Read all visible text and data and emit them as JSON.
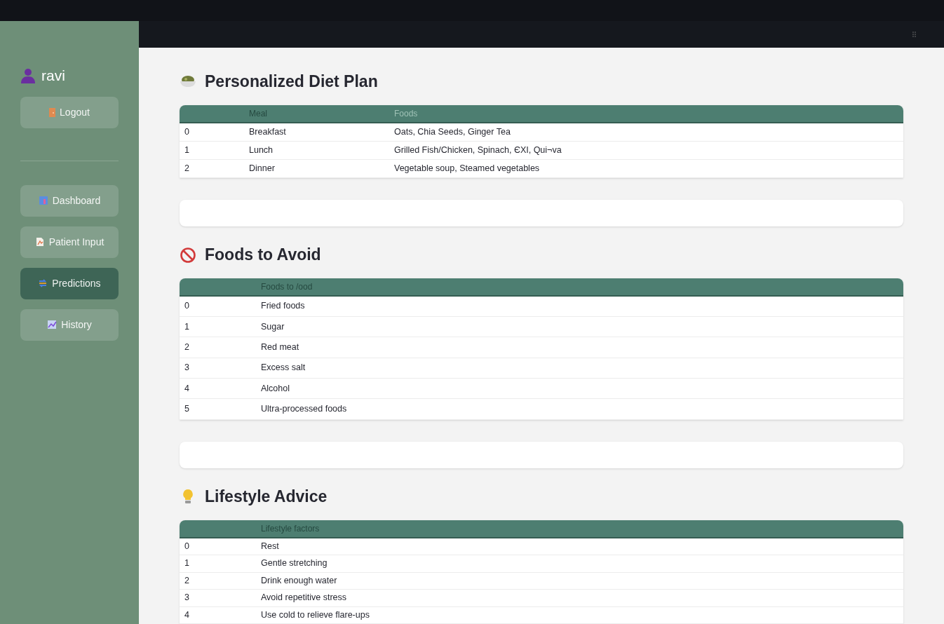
{
  "user": {
    "name": "ravi"
  },
  "logout": {
    "label": "Logout"
  },
  "nav": [
    {
      "label": "Dashboard",
      "kind": "chart",
      "selected": false
    },
    {
      "label": "Patient Input",
      "kind": "clipboard",
      "selected": false
    },
    {
      "label": "Predictions",
      "kind": "shuffle",
      "selected": true
    },
    {
      "label": "History",
      "kind": "trend",
      "selected": false
    }
  ],
  "sections": [
    {
      "title": "Personalized Diet Plan",
      "kind": "bowl",
      "table": {
        "columns": [
          "Meal",
          "Foods"
        ],
        "rows": [
          {
            "index": "0",
            "cells": [
              "Breakfast",
              "Oats, Chia Seeds, Ginger Tea"
            ]
          },
          {
            "index": "1",
            "cells": [
              "Lunch",
              "Grilled Fish/Chicken, Spinach, ЄXI, Qui¬va"
            ]
          },
          {
            "index": "2",
            "cells": [
              "Dinner",
              "Vegetable soup, Steamed vegetables"
            ]
          }
        ]
      }
    },
    {
      "title": "Foods to Avoid",
      "kind": "prohibited",
      "table": {
        "columns": [
          "Foods to /ood"
        ],
        "rows": [
          {
            "index": "0",
            "cells": [
              "Fried foods"
            ]
          },
          {
            "index": "1",
            "cells": [
              "Sugar"
            ]
          },
          {
            "index": "2",
            "cells": [
              "Red meat"
            ]
          },
          {
            "index": "3",
            "cells": [
              "Excess salt"
            ]
          },
          {
            "index": "4",
            "cells": [
              "Alcohol"
            ]
          },
          {
            "index": "5",
            "cells": [
              "Ultra-processed foods"
            ]
          }
        ]
      }
    },
    {
      "title": "Lifestyle Advice",
      "kind": "bulb",
      "table": {
        "columns": [
          "Lifestyle factors"
        ],
        "rows": [
          {
            "index": "0",
            "cells": [
              "Rest"
            ]
          },
          {
            "index": "1",
            "cells": [
              "Gentle stretching"
            ]
          },
          {
            "index": "2",
            "cells": [
              "Drink enough water"
            ]
          },
          {
            "index": "3",
            "cells": [
              "Avoid repetitive stress"
            ]
          },
          {
            "index": "4",
            "cells": [
              "Use cold to relieve flare-ups"
            ]
          }
        ]
      }
    }
  ]
}
